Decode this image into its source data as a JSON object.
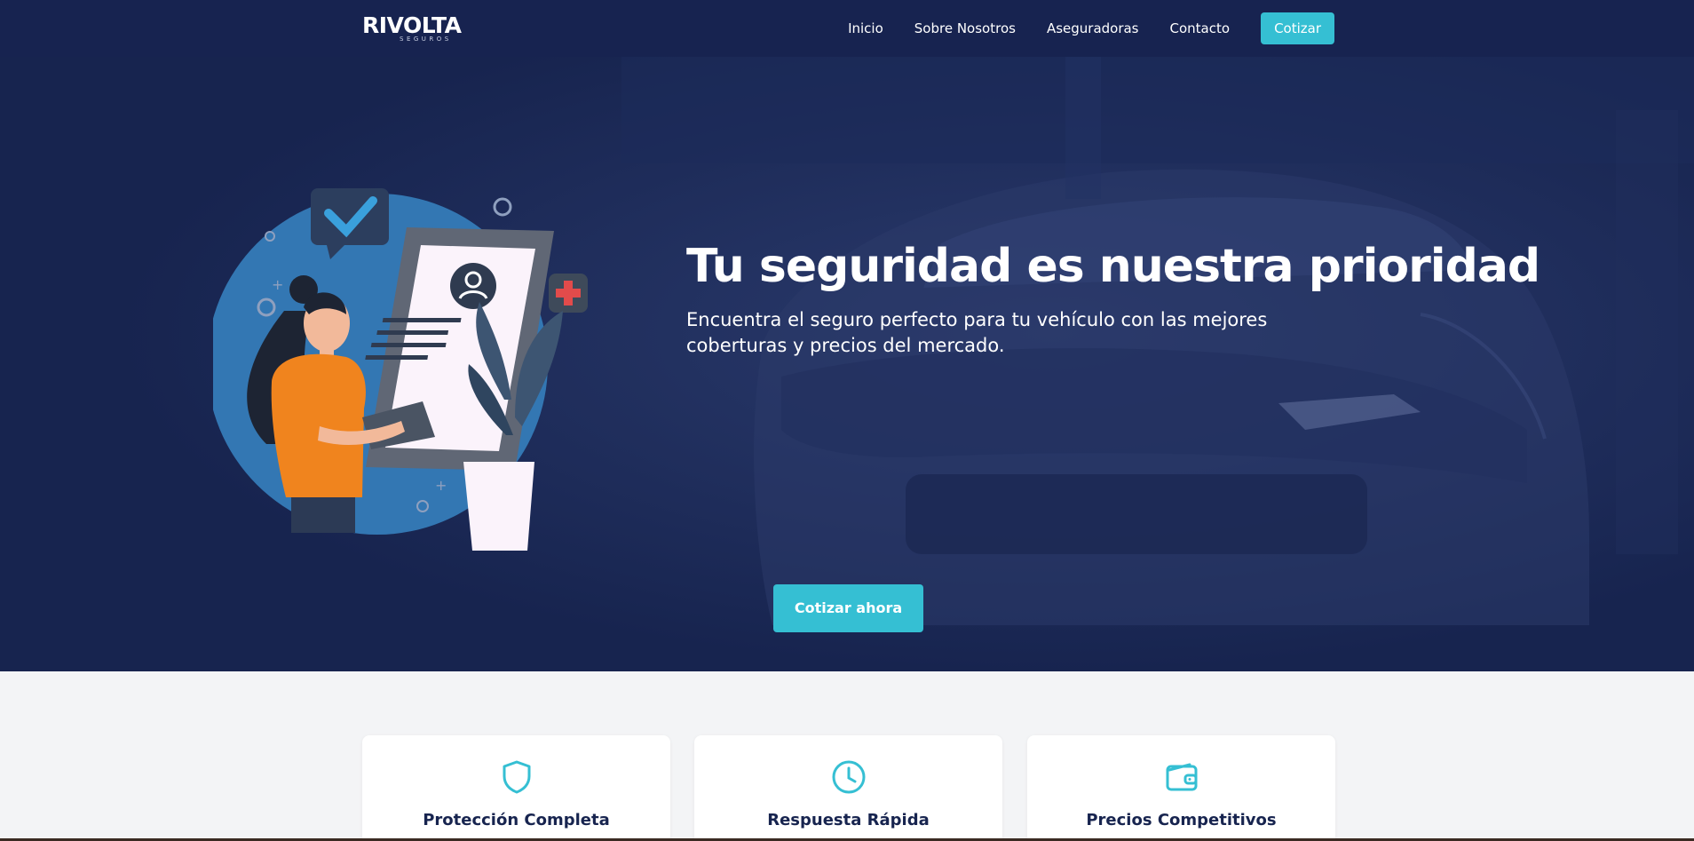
{
  "brand": {
    "name": "RIVOLTA",
    "tagline": "SEGUROS"
  },
  "nav": {
    "links": [
      "Inicio",
      "Sobre Nosotros",
      "Aseguradoras",
      "Contacto"
    ],
    "cta": "Cotizar"
  },
  "hero": {
    "title": "Tu seguridad es nuestra prioridad",
    "subtitle": "Encuentra el seguro perfecto para tu vehículo con las mejores coberturas y precios del mercado.",
    "button": "Cotizar ahora"
  },
  "features": [
    {
      "title": "Protección Completa",
      "icon": "shield-icon"
    },
    {
      "title": "Respuesta Rápida",
      "icon": "clock-icon"
    },
    {
      "title": "Precios Competitivos",
      "icon": "wallet-icon"
    }
  ],
  "colors": {
    "navy": "#172350",
    "accent": "#35bfd3",
    "light_bg": "#f3f4f6"
  }
}
